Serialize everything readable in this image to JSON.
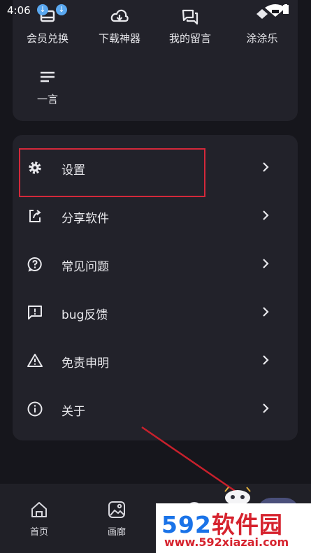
{
  "status_bar": {
    "time": "4:06",
    "download_badges": [
      "↓",
      "↓"
    ]
  },
  "shortcuts": [
    {
      "label": "会员兑换",
      "icon": "gift-card-icon"
    },
    {
      "label": "下载神器",
      "icon": "cloud-download-icon"
    },
    {
      "label": "我的留言",
      "icon": "forum-icon"
    },
    {
      "label": "涂涂乐",
      "icon": "paint-icon"
    },
    {
      "label": "一言",
      "icon": "notes-icon"
    }
  ],
  "menu": [
    {
      "label": "设置",
      "icon": "gear-icon"
    },
    {
      "label": "分享软件",
      "icon": "share-icon"
    },
    {
      "label": "常见问题",
      "icon": "help-icon"
    },
    {
      "label": "bug反馈",
      "icon": "feedback-icon"
    },
    {
      "label": "免责申明",
      "icon": "warning-icon"
    },
    {
      "label": "关于",
      "icon": "info-icon"
    }
  ],
  "bottom_nav": [
    {
      "label": "首页",
      "icon": "home-icon"
    },
    {
      "label": "画廊",
      "icon": "image-icon"
    }
  ],
  "watermark": {
    "digits": "592",
    "brand": "软件园",
    "url": "www.592xiazai.com"
  },
  "colors": {
    "background": "#16161c",
    "card": "#22222a",
    "highlight": "#d4283a",
    "watermark_blue": "#1a73e8",
    "watermark_red": "#d6232e"
  }
}
